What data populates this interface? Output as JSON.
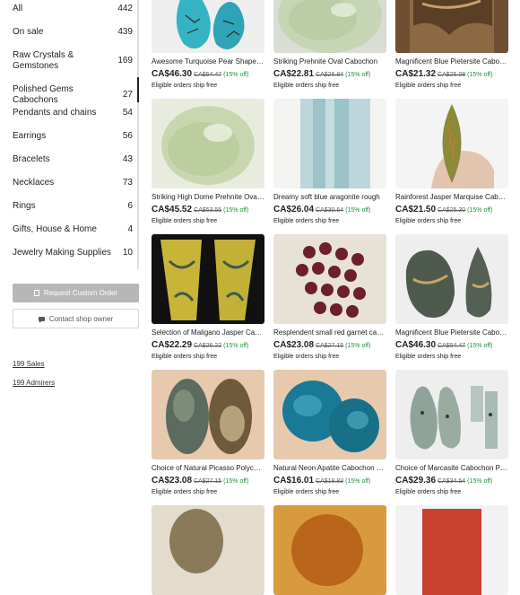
{
  "sidebar": {
    "categories": [
      {
        "label": "All",
        "count": "442"
      },
      {
        "label": "On sale",
        "count": "439"
      },
      {
        "label": "Raw Crystals & Gemstones",
        "count": "169"
      },
      {
        "label": "Polished Gems Cabochons",
        "count": "27"
      },
      {
        "label": "Pendants and chains",
        "count": "54"
      },
      {
        "label": "Earrings",
        "count": "56"
      },
      {
        "label": "Bracelets",
        "count": "43"
      },
      {
        "label": "Necklaces",
        "count": "73"
      },
      {
        "label": "Rings",
        "count": "6"
      },
      {
        "label": "Gifts, House & Home",
        "count": "4"
      },
      {
        "label": "Jewelry Making Supplies",
        "count": "10"
      }
    ],
    "request_label": "Request Custom Order",
    "contact_label": "Contact shop owner",
    "sales_label": "199 Sales",
    "admirers_label": "199 Admirers"
  },
  "listings": [
    {
      "title": "Awesome Turquoise Pear Shaped Cabochon Pair",
      "price": "CA$46.30",
      "original": "CA$54.47",
      "discount": "(15% off)",
      "shipping": "Eligible orders ship free"
    },
    {
      "title": "Striking Prehnite Oval Cabochon",
      "price": "CA$22.81",
      "original": "CA$26.84",
      "discount": "(15% off)",
      "shipping": "Eligible orders ship free"
    },
    {
      "title": "Magnificent Blue Pietersite Cabochon",
      "price": "CA$21.32",
      "original": "CA$25.08",
      "discount": "(15% off)",
      "shipping": "Eligible orders ship free"
    },
    {
      "title": "Striking High Dome Prehnite Oval Cabochon",
      "price": "CA$45.52",
      "original": "CA$53.55",
      "discount": "(15% off)",
      "shipping": "Eligible orders ship free"
    },
    {
      "title": "Dreamy soft blue aragonite rough",
      "price": "CA$26.04",
      "original": "CA$30.64",
      "discount": "(15% off)",
      "shipping": "Eligible orders ship free"
    },
    {
      "title": "Rainforest Jasper Marquise Cabochon",
      "price": "CA$21.50",
      "original": "CA$25.30",
      "discount": "(15% off)",
      "shipping": "Eligible orders ship free"
    },
    {
      "title": "Selection of Maligano Jasper Cabochons",
      "price": "CA$22.29",
      "original": "CA$26.22",
      "discount": "(15% off)",
      "shipping": "Eligible orders ship free"
    },
    {
      "title": "Resplendent small red garnet cabochons",
      "price": "CA$23.08",
      "original": "CA$27.15",
      "discount": "(15% off)",
      "shipping": "Eligible orders ship free"
    },
    {
      "title": "Magnificent Blue Pietersite Cabochon Pair",
      "price": "CA$46.30",
      "original": "CA$54.47",
      "discount": "(15% off)",
      "shipping": "Eligible orders ship free"
    },
    {
      "title": "Choice of Natural Picasso Polychrome Jasper",
      "price": "CA$23.08",
      "original": "CA$27.15",
      "discount": "(15% off)",
      "shipping": "Eligible orders ship free"
    },
    {
      "title": "Natural Neon Apatite Cabochon Pair",
      "price": "CA$16.01",
      "original": "CA$18.83",
      "discount": "(15% off)",
      "shipping": "Eligible orders ship free"
    },
    {
      "title": "Choice of Marcasite Cabochon Pairs",
      "price": "CA$29.36",
      "original": "CA$34.54",
      "discount": "(15% off)",
      "shipping": "Eligible orders ship free"
    }
  ]
}
